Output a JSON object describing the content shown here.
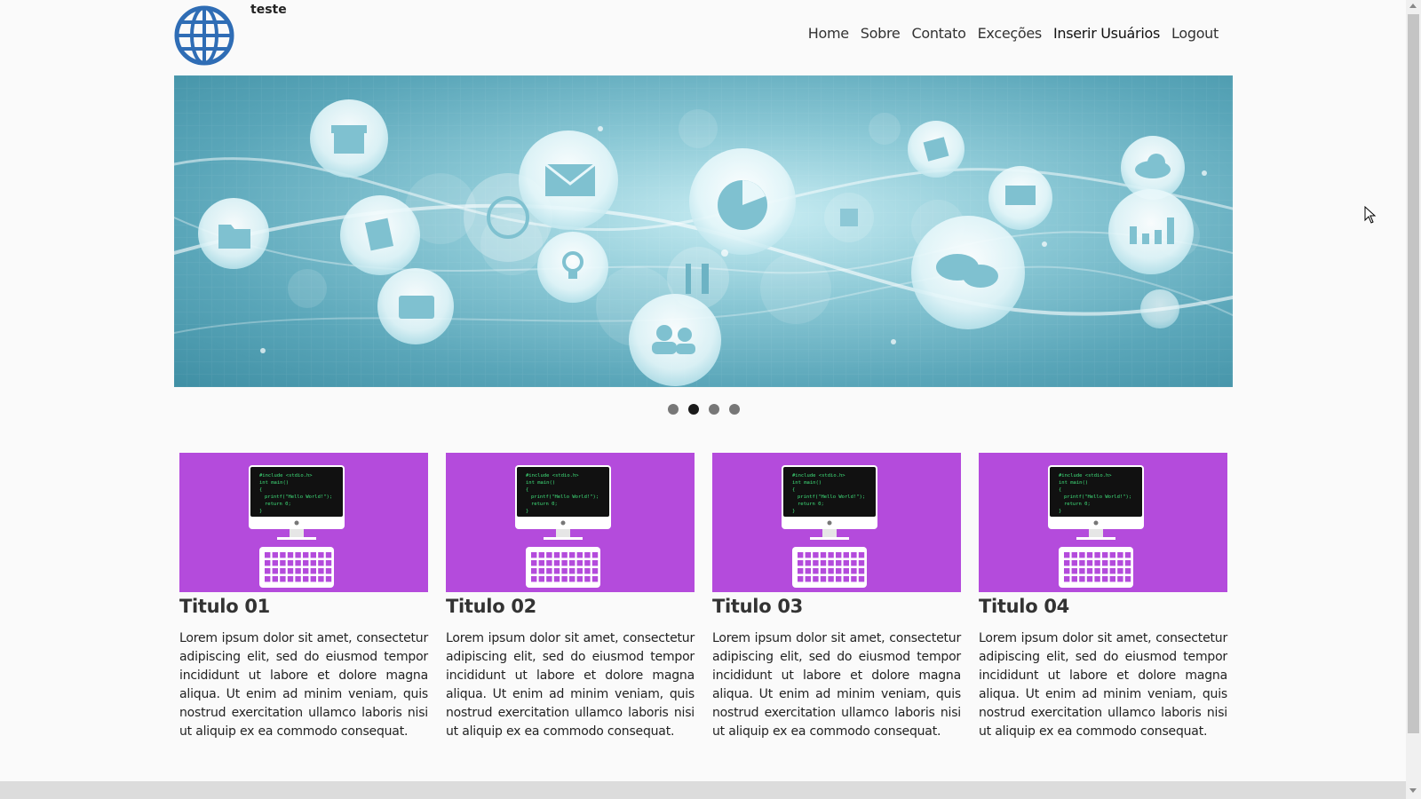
{
  "header": {
    "site_name": "teste",
    "logo_icon": "globe-icon",
    "nav": [
      "Home",
      "Sobre",
      "Contato",
      "Exceções",
      "Inserir Usuários",
      "Logout"
    ]
  },
  "banner": {
    "icons": [
      "gift-icon",
      "folder-icon",
      "document-icon",
      "tv-icon",
      "clock-icon",
      "envelope-icon",
      "lightbulb-icon",
      "pie-chart-icon",
      "restaurant-icon",
      "users-icon",
      "contacts-icon",
      "puzzle-icon",
      "chat-icon",
      "presentation-icon",
      "cloud-icon",
      "bar-chart-icon"
    ]
  },
  "carousel": {
    "slides": 4,
    "active": 2
  },
  "cards": [
    {
      "title": "Titulo 01",
      "text": "Lorem ipsum dolor sit amet, consectetur adipiscing elit, sed do eiusmod tempor incididunt ut labore et dolore magna aliqua. Ut enim ad minim veniam, quis nostrud exercitation ullamco laboris nisi ut aliquip ex ea commodo consequat."
    },
    {
      "title": "Titulo 02",
      "text": "Lorem ipsum dolor sit amet, consectetur adipiscing elit, sed do eiusmod tempor incididunt ut labore et dolore magna aliqua. Ut enim ad minim veniam, quis nostrud exercitation ullamco laboris nisi ut aliquip ex ea commodo consequat."
    },
    {
      "title": "Titulo 03",
      "text": "Lorem ipsum dolor sit amet, consectetur adipiscing elit, sed do eiusmod tempor incididunt ut labore et dolore magna aliqua. Ut enim ad minim veniam, quis nostrud exercitation ullamco laboris nisi ut aliquip ex ea commodo consequat."
    },
    {
      "title": "Titulo 04",
      "text": "Lorem ipsum dolor sit amet, consectetur adipiscing elit, sed do eiusmod tempor incididunt ut labore et dolore magna aliqua. Ut enim ad minim veniam, quis nostrud exercitation ullamco laboris nisi ut aliquip ex ea commodo consequat."
    }
  ],
  "card_image": {
    "icon": "computer-code-icon",
    "code_lines": [
      "#include <stdio.h>",
      "int main()",
      "{",
      "  printf(\"Hello World!\");",
      "  return 0;",
      "}"
    ]
  },
  "colors": {
    "card_bg": "#b44bdc",
    "banner_base": "#5aa6b9",
    "code_green": "#3fe07a"
  }
}
